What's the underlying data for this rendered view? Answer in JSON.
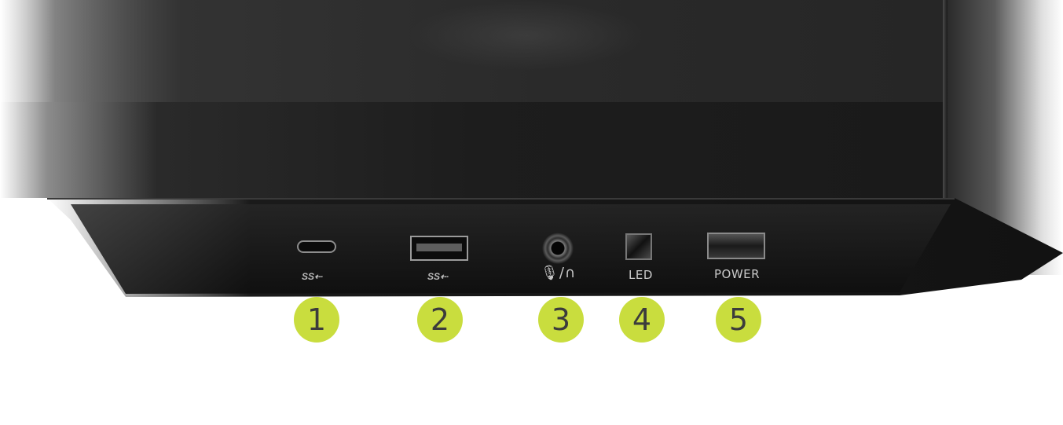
{
  "ports": [
    {
      "id": "usb-c",
      "logo": "SS⇠",
      "icon": "usb-c-port-icon"
    },
    {
      "id": "usb-a",
      "logo": "SS⇠",
      "icon": "usb-a-port-icon"
    },
    {
      "id": "audio",
      "logo": "🎙/∩",
      "icon": "combo-audio-jack-icon"
    },
    {
      "id": "led",
      "label": "LED",
      "icon": "led-button-icon"
    },
    {
      "id": "power",
      "label": "POWER",
      "icon": "power-button-icon"
    }
  ],
  "badges": [
    "1",
    "2",
    "3",
    "4",
    "5"
  ],
  "colors": {
    "badge": "#c9dd3e",
    "badge_text": "#3c3c3c",
    "bezel": "#141414"
  }
}
